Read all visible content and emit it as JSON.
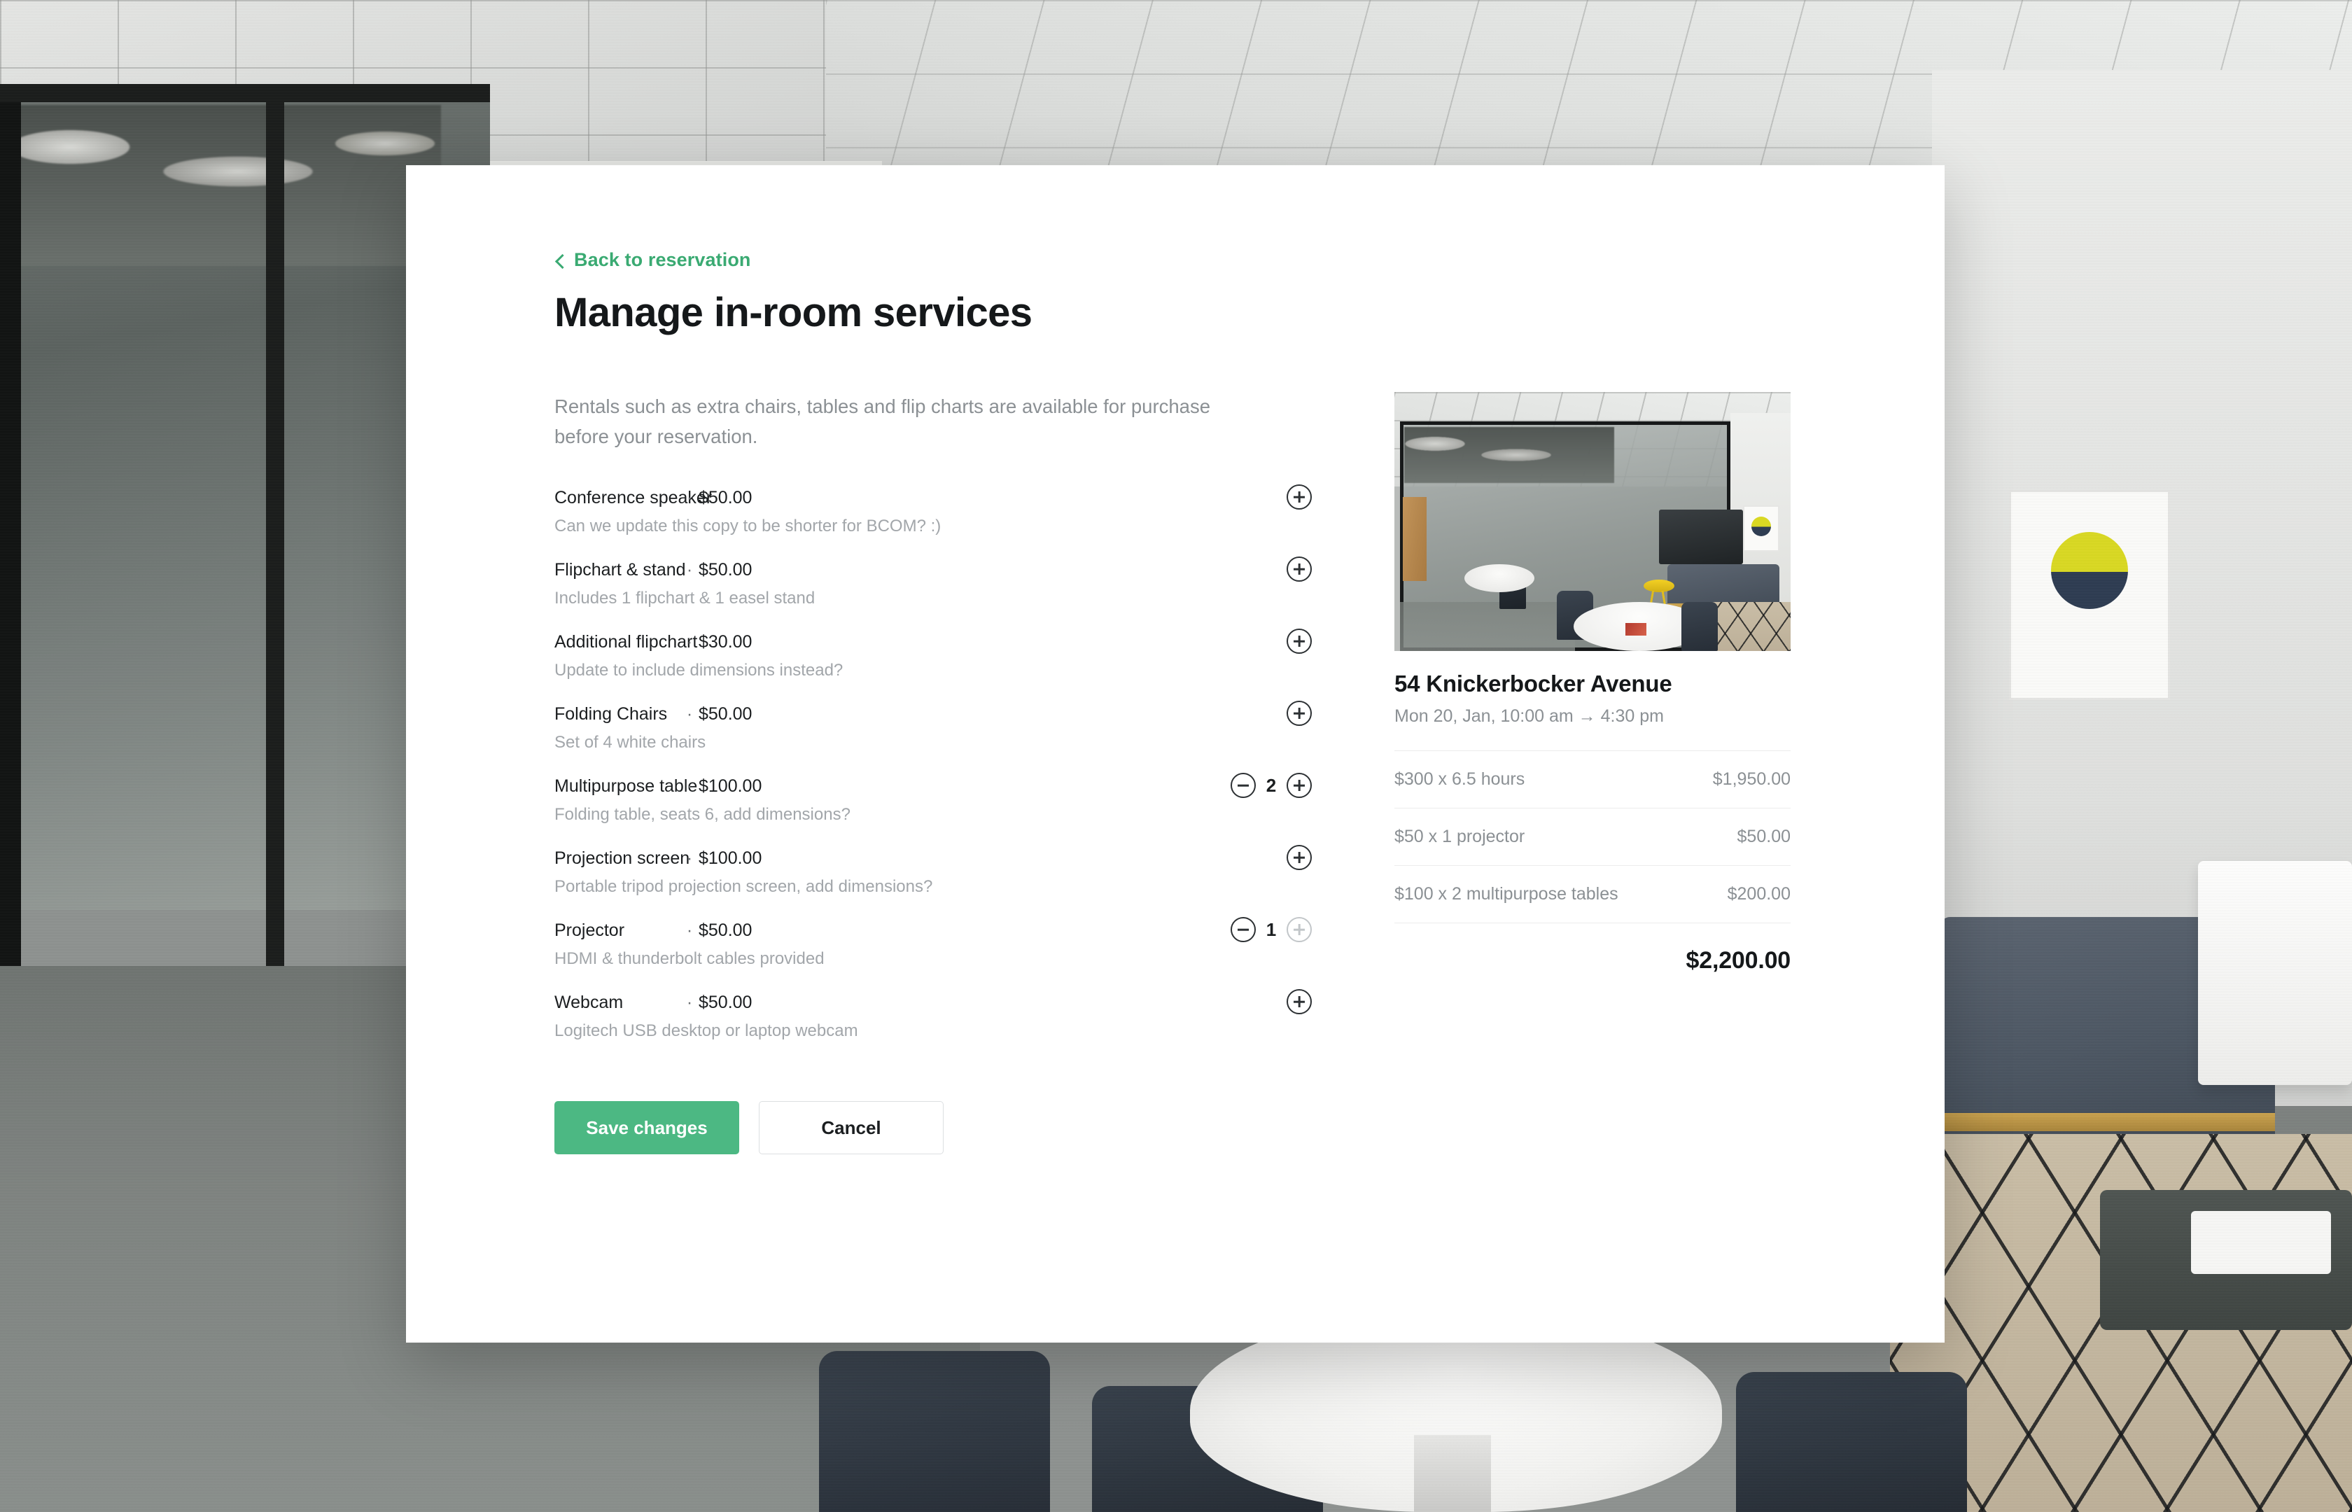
{
  "background": {
    "description": "office-interior-photo"
  },
  "modal": {
    "back_link": "Back to reservation",
    "title": "Manage in-room services",
    "intro": "Rentals such as extra chairs, tables and flip charts are available for purchase before your reservation.",
    "price_separator": "·",
    "services": [
      {
        "name": "Conference speaker",
        "price": "$50.00",
        "description": "Can we update this copy to be shorter for BCOM? :)",
        "quantity": null,
        "has_stepper": false,
        "plus_enabled": true
      },
      {
        "name": "Flipchart & stand",
        "price": "$50.00",
        "description": "Includes 1 flipchart & 1 easel stand",
        "quantity": null,
        "has_stepper": false,
        "plus_enabled": true
      },
      {
        "name": "Additional flipchart",
        "price": "$30.00",
        "description": "Update to include dimensions instead?",
        "quantity": null,
        "has_stepper": false,
        "plus_enabled": true
      },
      {
        "name": "Folding Chairs",
        "price": "$50.00",
        "description": "Set of 4 white chairs",
        "quantity": null,
        "has_stepper": false,
        "plus_enabled": true
      },
      {
        "name": "Multipurpose table",
        "price": "$100.00",
        "description": "Folding table, seats 6, add dimensions?",
        "quantity": "2",
        "has_stepper": true,
        "plus_enabled": true
      },
      {
        "name": "Projection screen",
        "price": "$100.00",
        "description": "Portable tripod projection screen, add dimensions?",
        "quantity": null,
        "has_stepper": false,
        "plus_enabled": true
      },
      {
        "name": "Projector",
        "price": "$50.00",
        "description": "HDMI & thunderbolt cables provided",
        "quantity": "1",
        "has_stepper": true,
        "plus_enabled": false
      },
      {
        "name": "Webcam",
        "price": "$50.00",
        "description": "Logitech USB desktop or laptop webcam",
        "quantity": null,
        "has_stepper": false,
        "plus_enabled": true
      }
    ],
    "actions": {
      "save_label": "Save changes",
      "cancel_label": "Cancel"
    },
    "summary": {
      "room_name": "54 Knickerbocker Avenue",
      "date_range": "Mon 20, Jan, 10:00 am → 4:30 pm",
      "line_items": [
        {
          "label": "$300 x 6.5 hours",
          "amount": "$1,950.00"
        },
        {
          "label": "$50 x 1 projector",
          "amount": "$50.00"
        },
        {
          "label": "$100 x 2 multipurpose tables",
          "amount": "$200.00"
        }
      ],
      "total": "$2,200.00"
    }
  },
  "colors": {
    "accent_green": "#4cb883",
    "link_green": "#3aaa72",
    "text_primary": "#15181a",
    "text_muted": "#8b9094",
    "divider": "#ececec"
  },
  "icons": {
    "back_chevron": "chevron-left-icon",
    "add": "plus-circle-icon",
    "remove": "minus-circle-icon"
  }
}
